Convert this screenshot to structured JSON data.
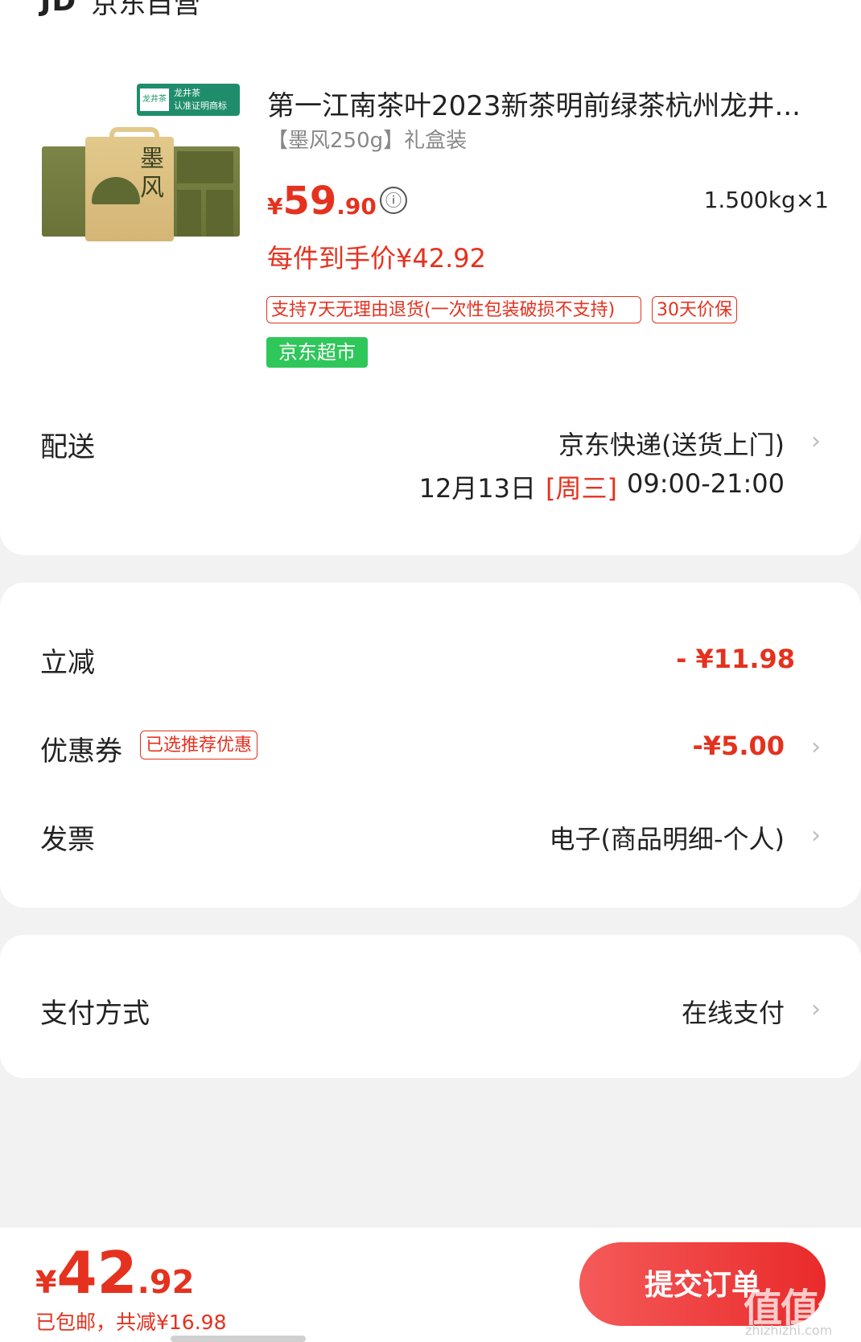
{
  "shop": {
    "logo": "JD",
    "name": "京东自营"
  },
  "product": {
    "image_badge_left": "龙井茶",
    "image_badge_right_1": "龙井茶",
    "image_badge_right_2": "认准证明商标",
    "image_text": "墨风",
    "title": "第一江南茶叶2023新茶明前绿茶杭州龙井...",
    "variant": "【墨风250g】礼盒装",
    "price_symbol": "¥",
    "price_int": "59",
    "price_dec": ".90",
    "info_icon": "ⓘ",
    "weight_qty": "1.500kg×1",
    "unit_price_text": "每件到手价¥42.92",
    "tags": {
      "return": "支持7天无理由退货(一次性包装破损不支持)",
      "protect": "30天价保",
      "market": "京东超市"
    }
  },
  "delivery": {
    "label": "配送",
    "method": "京东快递(送货上门)",
    "date": "12月13日",
    "weekday": "[周三]",
    "time": "09:00-21:00"
  },
  "discount": {
    "label": "立减",
    "value": "- ¥11.98"
  },
  "coupon": {
    "label": "优惠券",
    "tag": "已选推荐优惠",
    "value": "-¥5.00"
  },
  "invoice": {
    "label": "发票",
    "value": "电子(商品明细-个人)"
  },
  "payment": {
    "label": "支付方式",
    "value": "在线支付"
  },
  "chevron": "›",
  "footer": {
    "total_symbol": "¥",
    "total_int": "42",
    "total_dec": ".92",
    "summary": "已包邮，共减¥16.98",
    "submit_label": "提交订单",
    "watermark_glyph": "值值值",
    "watermark_url": "zhizhizhi.com"
  },
  "colors": {
    "accent": "#e4321f",
    "market_green": "#2fc75a",
    "background": "#f2f2f2"
  }
}
